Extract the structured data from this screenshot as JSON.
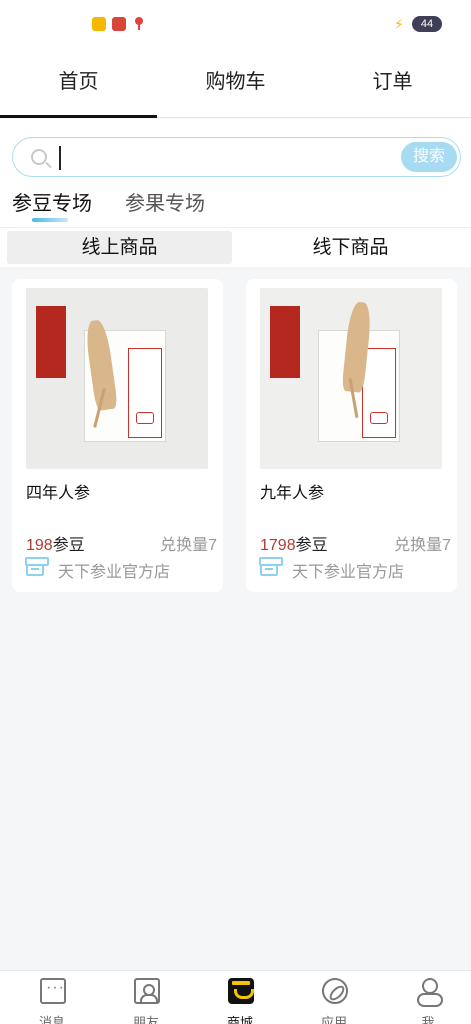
{
  "status_bar": {
    "battery": "44"
  },
  "top_nav": {
    "tabs": [
      {
        "label": "首页",
        "active": true
      },
      {
        "label": "购物车",
        "active": false
      },
      {
        "label": "订单",
        "active": false
      }
    ]
  },
  "search": {
    "placeholder": "",
    "value": "",
    "button_label": "搜索"
  },
  "category_tabs": [
    {
      "label": "参豆专场",
      "active": true
    },
    {
      "label": "参果专场",
      "active": false
    }
  ],
  "sub_tabs": [
    {
      "label": "线上商品",
      "active": true
    },
    {
      "label": "线下商品",
      "active": false
    }
  ],
  "products": [
    {
      "title": "四年人参",
      "price": "198",
      "unit": "参豆",
      "exchange": "兑换量7",
      "store": "天下参业官方店"
    },
    {
      "title": "九年人参",
      "price": "1798",
      "unit": "参豆",
      "exchange": "兑换量7",
      "store": "天下参业官方店"
    }
  ],
  "bottom_nav": {
    "items": [
      {
        "label": "消息",
        "icon": "message-icon",
        "active": false
      },
      {
        "label": "朋友",
        "icon": "contacts-icon",
        "active": false
      },
      {
        "label": "商城",
        "icon": "mall-icon",
        "active": true
      },
      {
        "label": "应用",
        "icon": "compass-icon",
        "active": false
      },
      {
        "label": "我",
        "icon": "profile-icon",
        "active": false
      }
    ]
  },
  "colors": {
    "accent": "#a6dbf2",
    "price": "#b23a32",
    "mall_active": "#f5c400"
  }
}
